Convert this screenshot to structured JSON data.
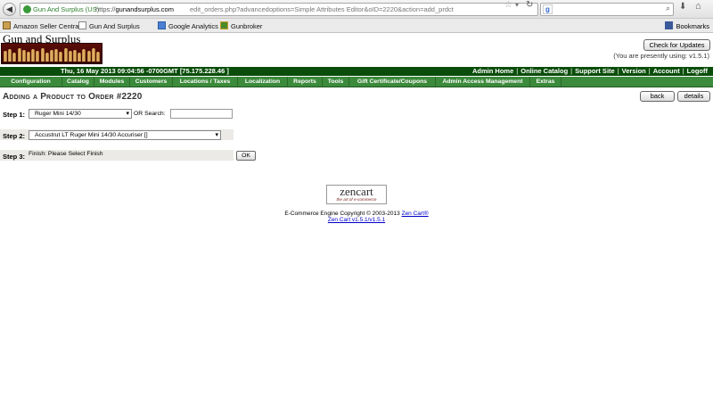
{
  "browser": {
    "back_glyph": "◀",
    "forward_glyph": "▶",
    "site_identity": "Gun And Surplus (US)",
    "url_scheme": "https://",
    "url_host": "gunandsurplus.com",
    "url_path": "edit_orders.php?advancedoptions=Simple Attributes Editor&oID=2220&action=add_prdct",
    "star_glyph": "☆",
    "dropdown_glyph": "▾",
    "reload_glyph": "↻",
    "search_engine_glyph": "g",
    "search_glyph": "⌕",
    "download_glyph": "⬇",
    "home_glyph": "⌂"
  },
  "bookmarks": {
    "items": [
      {
        "label": "Amazon Seller Central",
        "color": "#c8a050"
      },
      {
        "label": "Gun And Surplus",
        "color": "#ffffff"
      },
      {
        "label": "Google Analytics",
        "color": "#4a7fd4"
      },
      {
        "label": "Gunbroker",
        "color": "#4a8a2a"
      }
    ],
    "right_label": "Bookmarks"
  },
  "header": {
    "site_title": "Gun and Surplus",
    "check_updates_label": "Check for Updates",
    "version_note": "(You are presently using: v1.5.1)"
  },
  "status": {
    "date_line": "Thu, 16 May 2013 09:04:56 -0700GMT [75.175.228.46 ]",
    "links": [
      "Admin Home",
      "Online Catalog",
      "Support Site",
      "Version",
      "Account",
      "Logoff"
    ]
  },
  "menu": {
    "items": [
      "Configuration",
      "Catalog",
      "Modules",
      "Customers",
      "Locations / Taxes",
      "Localization",
      "Reports",
      "Tools",
      "Gift Certificate/Coupons",
      "Admin Access Management",
      "Extras"
    ]
  },
  "page": {
    "heading": "Adding a Product to Order #2220",
    "back_label": "back",
    "details_label": "details",
    "step1_label": "Step 1:",
    "step1_value": "Ruger Mini 14/30",
    "step1_search_label": "OR Search:",
    "step1_search_value": "",
    "step2_label": "Step 2:",
    "step2_value": "Accustrut LT Ruger Mini 14/30 Accuriser []",
    "step3_label": "Step 3:",
    "step3_text": "Finish: Please Select Finish",
    "ok_label": "OK"
  },
  "footer": {
    "logo_main": "zencart",
    "logo_tag": "the art of e-commerce",
    "copyright_text": "E-Commerce Engine Copyright © 2003-2013",
    "copyright_link": "Zen Cart®",
    "version_link": "Zen Cart v1.5.1/v1.5.1"
  },
  "colors": {
    "status_bar": "#0a4d0a",
    "menu_bar": "#3c8a3c",
    "link": "#0000cc"
  }
}
